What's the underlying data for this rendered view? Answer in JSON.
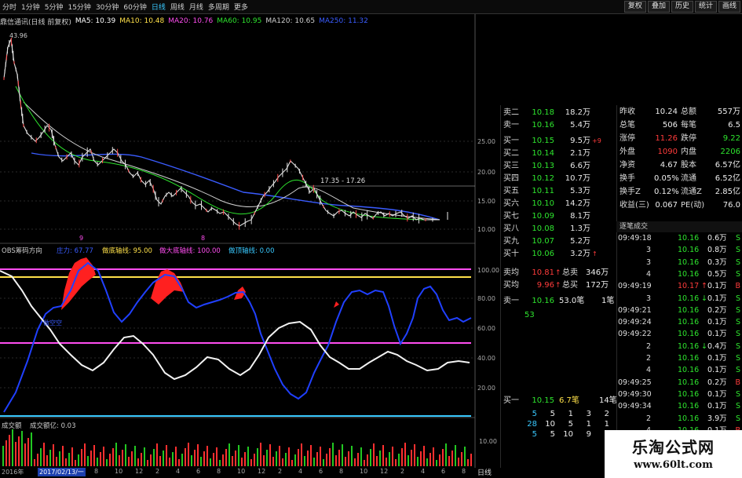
{
  "toolbar": {
    "periods": [
      "分时",
      "1分钟",
      "5分钟",
      "15分钟",
      "30分钟",
      "60分钟",
      "日线",
      "周线",
      "月线",
      "多周期",
      "更多"
    ],
    "active_period": "日线",
    "right_buttons": [
      "复权",
      "叠加",
      "历史",
      "统计",
      "画线"
    ]
  },
  "ma": {
    "title": "鼎信通讯(日线 前复权)",
    "items": [
      {
        "label": "MA5: 10.39",
        "color": "#ffffff"
      },
      {
        "label": "MA10: 10.48",
        "color": "#ffe14a"
      },
      {
        "label": "MA20: 10.76",
        "color": "#ff4df0"
      },
      {
        "label": "MA60: 10.95",
        "color": "#2ee52e"
      },
      {
        "label": "MA120: 10.65",
        "color": "#cfcfcf"
      },
      {
        "label": "MA250: 11.32",
        "color": "#3a5cff"
      }
    ]
  },
  "main_chart": {
    "price_high_label": "43.96",
    "range_label": "17.35 - 17.26",
    "right_axis": [
      "25.00",
      "20.00",
      "15.00",
      "10.00"
    ],
    "markers": [
      "9",
      "8"
    ]
  },
  "indicator": {
    "name": "OBS筹码方向",
    "items": [
      {
        "label": "庄力: 67.77",
        "color": "#3a5cff"
      },
      {
        "label": "做底轴线: 95.00",
        "color": "#ffe14a"
      },
      {
        "label": "做大底轴线: 100.00",
        "color": "#ff4df0"
      },
      {
        "label": "做顶轴线: 0.00",
        "color": "#39c9ff"
      }
    ],
    "right_axis": [
      "100.00",
      "80.00",
      "60.00",
      "40.00",
      "20.00"
    ],
    "inner_label": "做空空"
  },
  "volume": {
    "name": "成交额",
    "sub": "成交额亿: 0.03",
    "right_axis": [
      "10.00"
    ]
  },
  "dates": {
    "first": "2016年",
    "selected": "2017/02/13/一",
    "ticks": [
      "8",
      "10",
      "12",
      "2",
      "4",
      "6",
      "8",
      "10",
      "12",
      "2",
      "4",
      "6",
      "8",
      "10",
      "12",
      "2",
      "4",
      "6",
      "8"
    ]
  },
  "period_tab": "日线",
  "quote": {
    "top_partial": {
      "label": "卖二",
      "price": "10.18",
      "vol": "18.2万"
    },
    "sell1": {
      "label": "卖一",
      "price": "10.16",
      "vol": "5.4万"
    },
    "buys": [
      {
        "label": "买一",
        "price": "10.15",
        "vol": "9.5万",
        "mark": "+9"
      },
      {
        "label": "买二",
        "price": "10.14",
        "vol": "2.1万",
        "mark": ""
      },
      {
        "label": "买三",
        "price": "10.13",
        "vol": "6.6万",
        "mark": ""
      },
      {
        "label": "买四",
        "price": "10.12",
        "vol": "10.7万",
        "mark": ""
      },
      {
        "label": "买五",
        "price": "10.11",
        "vol": "5.3万",
        "mark": ""
      },
      {
        "label": "买六",
        "price": "10.10",
        "vol": "14.2万",
        "mark": ""
      },
      {
        "label": "买七",
        "price": "10.09",
        "vol": "8.1万",
        "mark": ""
      },
      {
        "label": "买八",
        "price": "10.08",
        "vol": "1.3万",
        "mark": ""
      },
      {
        "label": "买九",
        "price": "10.07",
        "vol": "5.2万",
        "mark": ""
      },
      {
        "label": "买十",
        "price": "10.06",
        "vol": "3.2万",
        "mark": "↑"
      }
    ],
    "avg_sell": {
      "label": "卖均",
      "price": "10.81",
      "arrow": "↑",
      "tlabel": "总卖",
      "val": "346万"
    },
    "avg_buy": {
      "label": "买均",
      "price": "9.96",
      "arrow": "↑",
      "tlabel": "总买",
      "val": "172万"
    },
    "sell_line": {
      "label": "卖一",
      "price": "10.16",
      "vol": "53.0笔",
      "cnt": "1笔"
    },
    "sell_queue": "53",
    "buy_line": {
      "label": "买一",
      "price": "10.15",
      "vol": "6.7笔",
      "cnt": "14笔"
    },
    "queue_rows": [
      [
        "5",
        "5",
        "1",
        "3",
        "2"
      ],
      [
        "28",
        "10",
        "5",
        "1",
        "1"
      ],
      [
        "5",
        "5",
        "10",
        "9",
        ""
      ]
    ]
  },
  "info": {
    "rows": [
      {
        "l1": "昨收",
        "v1": "10.24",
        "l2": "总额",
        "v2": "557万"
      },
      {
        "l1": "总笔",
        "v1": "506",
        "l2": "每笔",
        "v2": "6.5"
      },
      {
        "l1": "涨停",
        "v1": "11.26",
        "l2": "跌停",
        "v2": "9.22"
      },
      {
        "l1": "外盘",
        "v1": "1090",
        "l2": "内盘",
        "v2": "2206"
      },
      {
        "l1": "净资",
        "v1": "4.67",
        "l2": "股本",
        "v2": "6.57亿"
      },
      {
        "l1": "换手",
        "v1": "0.05%",
        "l2": "流通",
        "v2": "6.52亿"
      },
      {
        "l1": "换手Z",
        "v1": "0.12%",
        "l2": "流通Z",
        "v2": "2.85亿"
      },
      {
        "l1": "收益(三)",
        "v1": "0.067",
        "l2": "PE(动)",
        "v2": "76.0"
      }
    ]
  },
  "ticks": {
    "title": "逐笔成交",
    "rows": [
      {
        "t": "09:49:18",
        "p": "10.16",
        "a": "",
        "v": "0.6万",
        "s": "S"
      },
      {
        "t": "3",
        "p": "10.16",
        "a": "",
        "v": "0.8万",
        "s": "S"
      },
      {
        "t": "3",
        "p": "10.16",
        "a": "",
        "v": "0.3万",
        "s": "S"
      },
      {
        "t": "4",
        "p": "10.16",
        "a": "",
        "v": "0.5万",
        "s": "S"
      },
      {
        "t": "09:49:19",
        "p": "10.17",
        "a": "↑",
        "v": "0.1万",
        "s": "B"
      },
      {
        "t": "3",
        "p": "10.16",
        "a": "↓",
        "v": "0.1万",
        "s": "S"
      },
      {
        "t": "09:49:21",
        "p": "10.16",
        "a": "",
        "v": "0.2万",
        "s": "S"
      },
      {
        "t": "09:49:24",
        "p": "10.16",
        "a": "",
        "v": "0.1万",
        "s": "S"
      },
      {
        "t": "09:49:22",
        "p": "10.16",
        "a": "",
        "v": "0.1万",
        "s": "S"
      },
      {
        "t": "2",
        "p": "10.16",
        "a": "↓",
        "v": "0.4万",
        "s": "S"
      },
      {
        "t": "2",
        "p": "10.16",
        "a": "",
        "v": "0.1万",
        "s": "S"
      },
      {
        "t": "4",
        "p": "10.16",
        "a": "",
        "v": "0.1万",
        "s": "S"
      },
      {
        "t": "09:49:25",
        "p": "10.16",
        "a": "",
        "v": "0.2万",
        "s": "B"
      },
      {
        "t": "09:49:30",
        "p": "10.16",
        "a": "",
        "v": "0.1万",
        "s": "S"
      },
      {
        "t": "09:49:34",
        "p": "10.16",
        "a": "",
        "v": "0.1万",
        "s": "S"
      },
      {
        "t": "2",
        "p": "10.16",
        "a": "",
        "v": "3.9万",
        "s": "S"
      },
      {
        "t": "4",
        "p": "10.16",
        "a": "",
        "v": "0.1万",
        "s": "B"
      }
    ]
  },
  "watermark": {
    "line1": "乐淘公式网",
    "line2": "www.60lt.com"
  }
}
